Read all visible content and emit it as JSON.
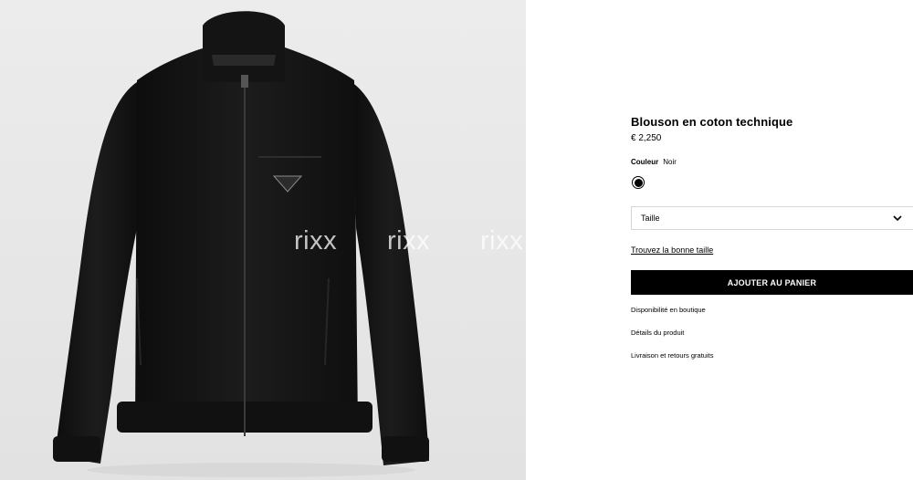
{
  "product": {
    "title": "Blouson en coton technique",
    "price": "€ 2,250",
    "color_label": "Couleur",
    "color_value": "Noir",
    "swatch_color": "#000000",
    "size_placeholder": "Taille",
    "size_guide_link": "Trouvez la bonne taille",
    "add_to_cart": "AJOUTER AU PANIER",
    "links": [
      "Disponibilité en boutique",
      "Détails du produit",
      "Livraison et retours gratuits"
    ]
  },
  "image": {
    "subject": "black zip-up track jacket",
    "watermarks": [
      "rixx",
      "rixx",
      "rixx"
    ],
    "background_color": "#e8e8e8"
  },
  "icons": {
    "size_dropdown": "chevron-down-icon"
  }
}
